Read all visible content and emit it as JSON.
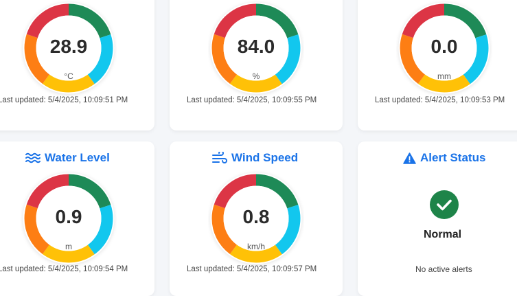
{
  "gauges": [
    {
      "value": "28.9",
      "unit": "°C",
      "updated": "Last updated: 5/4/2025, 10:09:51 PM"
    },
    {
      "value": "84.0",
      "unit": "%",
      "updated": "Last updated: 5/4/2025, 10:09:55 PM"
    },
    {
      "value": "0.0",
      "unit": "mm",
      "updated": "Last updated: 5/4/2025, 10:09:53 PM"
    },
    {
      "title": "Water Level",
      "icon": "water-waves-icon",
      "value": "0.9",
      "unit": "m",
      "updated": "Last updated: 5/4/2025, 10:09:54 PM"
    },
    {
      "title": "Wind Speed",
      "icon": "wind-icon",
      "value": "0.8",
      "unit": "km/h",
      "updated": "Last updated: 5/4/2025, 10:09:57 PM"
    }
  ],
  "alert": {
    "title": "Alert Status",
    "icon": "warning-icon",
    "status": "Normal",
    "status_icon": "check-circle-icon",
    "message": "No active alerts"
  },
  "colors": {
    "accent": "#1a73e8",
    "segments": [
      "#1e8a57",
      "#12c7ee",
      "#ffc107",
      "#fd7e14",
      "#dc3545"
    ],
    "ok": "#1e8449"
  }
}
